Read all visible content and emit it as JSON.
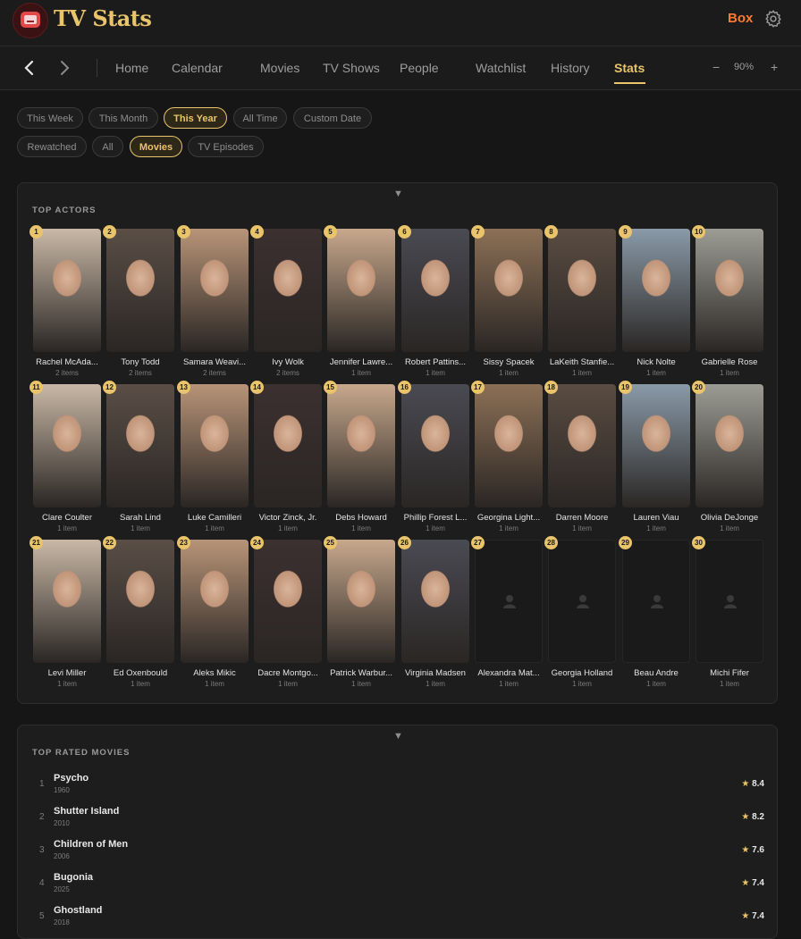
{
  "app": {
    "title": "TV Stats",
    "user": "Box"
  },
  "nav": {
    "items": [
      "Home",
      "Calendar",
      "Movies",
      "TV Shows",
      "People",
      "Watchlist",
      "History",
      "Stats"
    ],
    "active": "Stats",
    "zoom": "90%",
    "zoom_out": "−",
    "zoom_in": "+"
  },
  "filters": {
    "period": [
      "This Week",
      "This Month",
      "This Year",
      "All Time",
      "Custom Date"
    ],
    "period_active": "This Year",
    "type": [
      "Rewatched",
      "All",
      "Movies",
      "TV Episodes"
    ],
    "type_active": "Movies"
  },
  "top_actors": {
    "heading": "TOP ACTORS",
    "toggle": "▼",
    "actors": [
      {
        "rank": "1",
        "name": "Rachel McAda...",
        "count": "2 items",
        "photo": true
      },
      {
        "rank": "2",
        "name": "Tony Todd",
        "count": "2 items",
        "photo": true
      },
      {
        "rank": "3",
        "name": "Samara Weavi...",
        "count": "2 items",
        "photo": true
      },
      {
        "rank": "4",
        "name": "Ivy Wolk",
        "count": "2 items",
        "photo": true
      },
      {
        "rank": "5",
        "name": "Jennifer Lawre...",
        "count": "1 item",
        "photo": true
      },
      {
        "rank": "6",
        "name": "Robert Pattins...",
        "count": "1 item",
        "photo": true
      },
      {
        "rank": "7",
        "name": "Sissy Spacek",
        "count": "1 item",
        "photo": true
      },
      {
        "rank": "8",
        "name": "LaKeith Stanfie...",
        "count": "1 item",
        "photo": true
      },
      {
        "rank": "9",
        "name": "Nick Nolte",
        "count": "1 item",
        "photo": true
      },
      {
        "rank": "10",
        "name": "Gabrielle Rose",
        "count": "1 item",
        "photo": true
      },
      {
        "rank": "11",
        "name": "Clare Coulter",
        "count": "1 item",
        "photo": true
      },
      {
        "rank": "12",
        "name": "Sarah Lind",
        "count": "1 item",
        "photo": true
      },
      {
        "rank": "13",
        "name": "Luke Camilleri",
        "count": "1 item",
        "photo": true
      },
      {
        "rank": "14",
        "name": "Victor Zinck, Jr.",
        "count": "1 item",
        "photo": true
      },
      {
        "rank": "15",
        "name": "Debs Howard",
        "count": "1 item",
        "photo": true
      },
      {
        "rank": "16",
        "name": "Phillip Forest L...",
        "count": "1 item",
        "photo": true
      },
      {
        "rank": "17",
        "name": "Georgina Light...",
        "count": "1 item",
        "photo": true
      },
      {
        "rank": "18",
        "name": "Darren Moore",
        "count": "1 item",
        "photo": true
      },
      {
        "rank": "19",
        "name": "Lauren Viau",
        "count": "1 item",
        "photo": true
      },
      {
        "rank": "20",
        "name": "Olivia DeJonge",
        "count": "1 item",
        "photo": true
      },
      {
        "rank": "21",
        "name": "Levi Miller",
        "count": "1 item",
        "photo": true
      },
      {
        "rank": "22",
        "name": "Ed Oxenbould",
        "count": "1 item",
        "photo": true
      },
      {
        "rank": "23",
        "name": "Aleks Mikic",
        "count": "1 item",
        "photo": true
      },
      {
        "rank": "24",
        "name": "Dacre Montgo...",
        "count": "1 item",
        "photo": true
      },
      {
        "rank": "25",
        "name": "Patrick Warbur...",
        "count": "1 item",
        "photo": true
      },
      {
        "rank": "26",
        "name": "Virginia Madsen",
        "count": "1 item",
        "photo": true
      },
      {
        "rank": "27",
        "name": "Alexandra Mat...",
        "count": "1 item",
        "photo": false
      },
      {
        "rank": "28",
        "name": "Georgia Holland",
        "count": "1 item",
        "photo": false
      },
      {
        "rank": "29",
        "name": "Beau Andre",
        "count": "1 item",
        "photo": false
      },
      {
        "rank": "30",
        "name": "Michi Fifer",
        "count": "1 item",
        "photo": false
      }
    ]
  },
  "top_rated_movies": {
    "heading": "TOP RATED MOVIES",
    "toggle": "▼",
    "movies": [
      {
        "rank": "1",
        "title": "Psycho",
        "year": "1960",
        "rating": "8.4"
      },
      {
        "rank": "2",
        "title": "Shutter Island",
        "year": "2010",
        "rating": "8.2"
      },
      {
        "rank": "3",
        "title": "Children of Men",
        "year": "2006",
        "rating": "7.6"
      },
      {
        "rank": "4",
        "title": "Bugonia",
        "year": "2025",
        "rating": "7.4"
      },
      {
        "rank": "5",
        "title": "Ghostland",
        "year": "2018",
        "rating": "7.4"
      }
    ]
  },
  "colors": {
    "accent": "#e9c46a",
    "user": "#ff7a2e",
    "background": "#161616"
  },
  "icons": [
    "app-logo-icon",
    "gear-icon",
    "chevron-left-icon",
    "chevron-right-icon",
    "person-placeholder-icon",
    "star-icon",
    "triangle-down-icon"
  ]
}
